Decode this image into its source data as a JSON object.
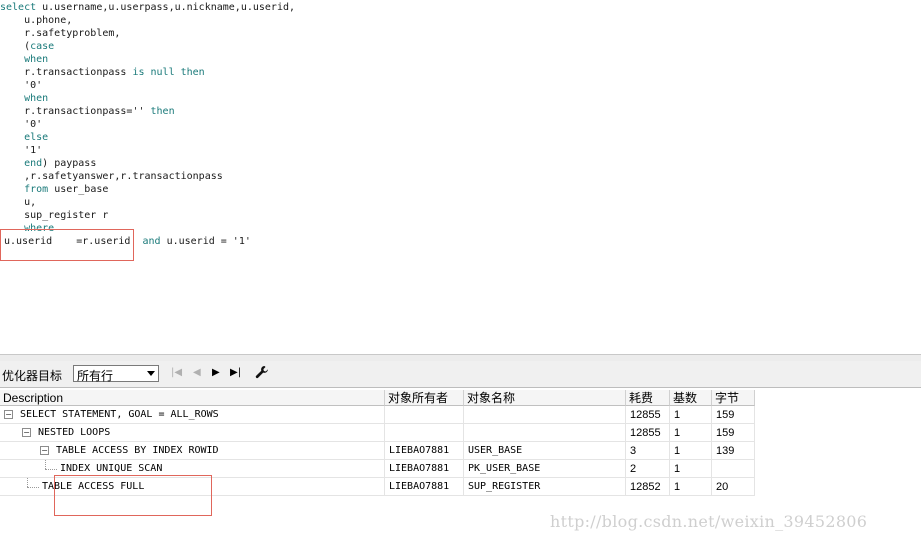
{
  "editor": {
    "lines": [
      [
        {
          "t": "select",
          "k": 1
        },
        {
          "t": " u.username,u.userpass,u.nickname,u.userid,"
        }
      ],
      [
        {
          "t": "    u.phone,"
        }
      ],
      [
        {
          "t": "    r.safetyproblem,"
        }
      ],
      [
        {
          "t": "    (",
          "k": 0
        },
        {
          "t": "case",
          "k": 1
        }
      ],
      [
        {
          "t": "    "
        },
        {
          "t": "when",
          "k": 1
        }
      ],
      [
        {
          "t": "    r.transactionpass "
        },
        {
          "t": "is null then",
          "k": 1
        }
      ],
      [
        {
          "t": "    '0'"
        }
      ],
      [
        {
          "t": "    "
        },
        {
          "t": "when",
          "k": 1
        }
      ],
      [
        {
          "t": "    r.transactionpass='' "
        },
        {
          "t": "then",
          "k": 1
        }
      ],
      [
        {
          "t": "    '0'"
        }
      ],
      [
        {
          "t": "    "
        },
        {
          "t": "else",
          "k": 1
        }
      ],
      [
        {
          "t": "    '1'"
        }
      ],
      [
        {
          "t": "    "
        },
        {
          "t": "end",
          "k": 1
        },
        {
          "t": ") paypass"
        }
      ],
      [
        {
          "t": "    ,r.safetyanswer,r.transactionpass"
        }
      ],
      [
        {
          "t": "    "
        },
        {
          "t": "from",
          "k": 1
        },
        {
          "t": " user_base"
        }
      ],
      [
        {
          "t": "    u,"
        }
      ],
      [
        {
          "t": "    sup_register r"
        }
      ],
      [
        {
          "t": "    "
        },
        {
          "t": "where",
          "k": 1
        }
      ],
      [
        {
          "t": "u.userid    =r.userid  "
        },
        {
          "t": "and",
          "k": 1
        },
        {
          "t": " u.userid = '1'"
        }
      ]
    ]
  },
  "toolbar": {
    "optimizer_label": "优化器目标",
    "optimizer_value": "所有行"
  },
  "grid": {
    "headers": [
      "Description",
      "对象所有者",
      "对象名称",
      "耗费",
      "基数",
      "字节"
    ],
    "rows": [
      {
        "desc": "SELECT STATEMENT, GOAL = ALL_ROWS",
        "owner": "",
        "name": "",
        "cost": "12855",
        "card": "1",
        "bytes": "159"
      },
      {
        "desc": "NESTED LOOPS",
        "owner": "",
        "name": "",
        "cost": "12855",
        "card": "1",
        "bytes": "159"
      },
      {
        "desc": "TABLE ACCESS BY INDEX ROWID",
        "owner": "LIEBAO7881",
        "name": "USER_BASE",
        "cost": "3",
        "card": "1",
        "bytes": "139"
      },
      {
        "desc": "INDEX UNIQUE SCAN",
        "owner": "LIEBAO7881",
        "name": "PK_USER_BASE",
        "cost": "2",
        "card": "1",
        "bytes": ""
      },
      {
        "desc": "TABLE ACCESS FULL",
        "owner": "LIEBAO7881",
        "name": "SUP_REGISTER",
        "cost": "12852",
        "card": "1",
        "bytes": "20"
      }
    ]
  },
  "watermark": "http://blog.csdn.net/weixin_39452806"
}
